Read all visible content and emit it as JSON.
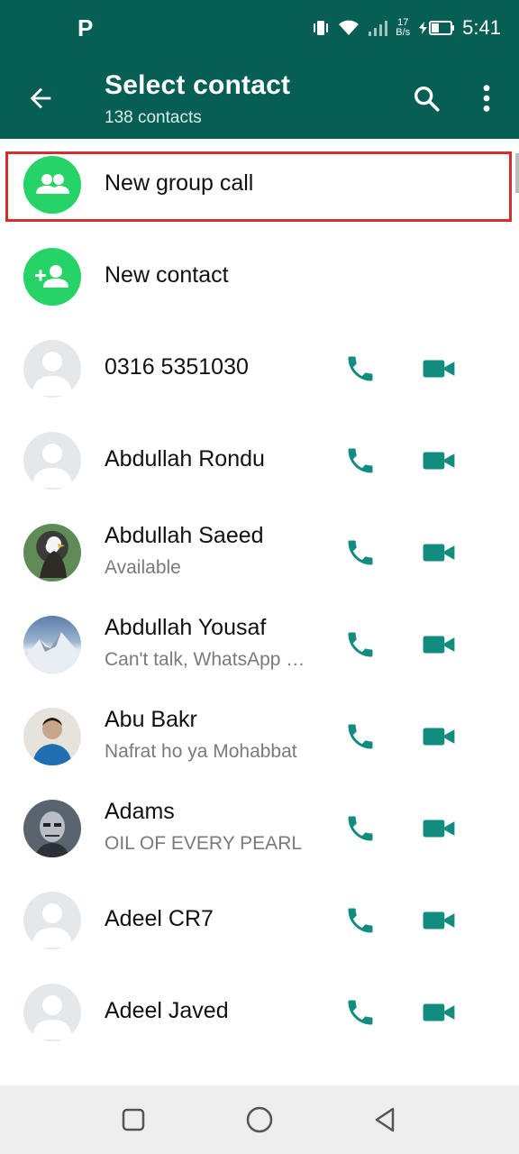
{
  "status_bar": {
    "carrier_icon": "P",
    "speed_top": "17",
    "speed_bottom": "B/s",
    "time": "5:41"
  },
  "header": {
    "title": "Select contact",
    "subtitle": "138 contacts"
  },
  "actions": [
    {
      "label": "New group call",
      "icon": "group-icon"
    },
    {
      "label": "New contact",
      "icon": "add-contact-icon"
    }
  ],
  "contacts": [
    {
      "name": "0316 5351030",
      "status": "",
      "avatar": "default"
    },
    {
      "name": "Abdullah Rondu",
      "status": "",
      "avatar": "default"
    },
    {
      "name": "Abdullah Saeed",
      "status": "Available",
      "avatar": "photo-eagle"
    },
    {
      "name": "Abdullah Yousaf",
      "status": "Can't talk, WhatsApp only",
      "avatar": "photo-mountain"
    },
    {
      "name": "Abu Bakr",
      "status": "Nafrat ho ya Mohabbat",
      "avatar": "photo-man"
    },
    {
      "name": "Adams",
      "status": "OIL OF EVERY PEARL",
      "avatar": "photo-robot"
    },
    {
      "name": "Adeel CR7",
      "status": "",
      "avatar": "default"
    },
    {
      "name": "Adeel Javed",
      "status": "",
      "avatar": "default"
    }
  ],
  "colors": {
    "primary": "#075e54",
    "accent": "#25d366",
    "icon_teal": "#128c7e",
    "highlight": "#d32f2f"
  }
}
